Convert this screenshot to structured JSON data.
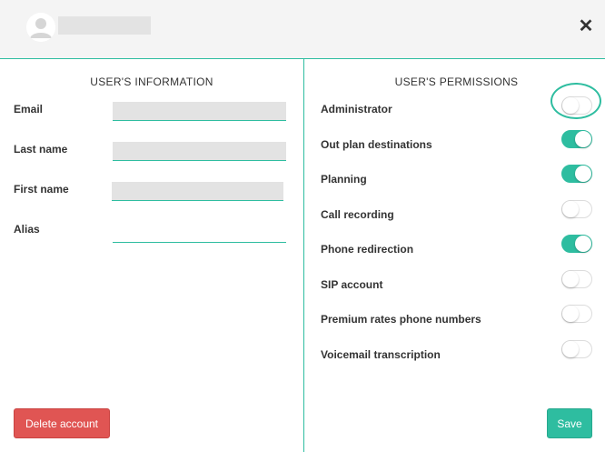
{
  "header": {
    "avatar_icon": "user-avatar-icon",
    "close_label": "✕",
    "close_icon": "close-icon"
  },
  "user_info": {
    "title": "USER'S INFORMATION",
    "fields": [
      {
        "label": "Email",
        "value": ""
      },
      {
        "label": "Last name",
        "value": ""
      },
      {
        "label": "First name",
        "value": ""
      },
      {
        "label": "Alias",
        "value": ""
      }
    ]
  },
  "permissions": {
    "title": "USER'S PERMISSIONS",
    "items": [
      {
        "label": "Administrator",
        "enabled": false
      },
      {
        "label": "Out plan destinations",
        "enabled": true
      },
      {
        "label": "Planning",
        "enabled": true
      },
      {
        "label": "Call recording",
        "enabled": false
      },
      {
        "label": "Phone redirection",
        "enabled": true
      },
      {
        "label": "SIP account",
        "enabled": false
      },
      {
        "label": "Premium rates phone numbers",
        "enabled": false
      },
      {
        "label": "Voicemail transcription",
        "enabled": false
      }
    ]
  },
  "actions": {
    "delete_label": "Delete account",
    "save_label": "Save"
  },
  "colors": {
    "accent": "#2ebda0",
    "danger": "#e05553",
    "header_bg": "#f4f4f4",
    "placeholder": "#e3e3e3"
  }
}
